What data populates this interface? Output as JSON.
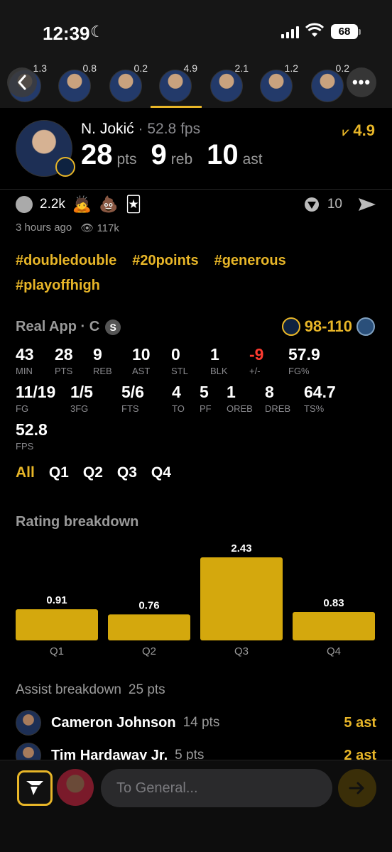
{
  "status": {
    "time": "12:39",
    "battery": "68"
  },
  "strip": {
    "players": [
      {
        "score": "1.3"
      },
      {
        "score": "0.8"
      },
      {
        "score": "0.2"
      },
      {
        "score": "4.9"
      },
      {
        "score": "2.1"
      },
      {
        "score": "1.2"
      },
      {
        "score": "0.2"
      }
    ],
    "active_index": 3
  },
  "player": {
    "name": "N. Jokić",
    "fps_text": "· 52.8 fps",
    "rating": "4.9",
    "pts": "28",
    "pts_label": "pts",
    "reb": "9",
    "reb_label": "reb",
    "ast": "10",
    "ast_label": "ast"
  },
  "reactions": {
    "count": "2.2k",
    "emoji": [
      "🙇",
      "💩",
      "🃏"
    ],
    "shares": "10",
    "time_ago": "3 hours ago",
    "views": "117k"
  },
  "tags": [
    "#doubledouble",
    "#20points",
    "#generous",
    "#playoffhigh"
  ],
  "game": {
    "source": "Real App · C",
    "badge": "S",
    "score_home": "98",
    "score_sep": "-",
    "score_away": "110"
  },
  "stats_row1": [
    {
      "v": "43",
      "k": "MIN"
    },
    {
      "v": "28",
      "k": "PTS"
    },
    {
      "v": "9",
      "k": "REB"
    },
    {
      "v": "10",
      "k": "AST"
    },
    {
      "v": "0",
      "k": "STL"
    },
    {
      "v": "1",
      "k": "BLK"
    },
    {
      "v": "-9",
      "k": "+/-"
    },
    {
      "v": "57.9",
      "k": "FG%"
    }
  ],
  "stats_row2": [
    {
      "v": "11/19",
      "k": "FG"
    },
    {
      "v": "1/5",
      "k": "3FG"
    },
    {
      "v": "5/6",
      "k": "FTS"
    },
    {
      "v": "4",
      "k": "TO"
    },
    {
      "v": "5",
      "k": "PF"
    },
    {
      "v": "1",
      "k": "OREB"
    },
    {
      "v": "8",
      "k": "DREB"
    },
    {
      "v": "64.7",
      "k": "TS%"
    }
  ],
  "stats_row3": [
    {
      "v": "52.8",
      "k": "FPS"
    }
  ],
  "quarter_tabs": [
    "All",
    "Q1",
    "Q2",
    "Q3",
    "Q4"
  ],
  "rating_title": "Rating breakdown",
  "chart_data": {
    "type": "bar",
    "categories": [
      "Q1",
      "Q2",
      "Q3",
      "Q4"
    ],
    "values": [
      0.91,
      0.76,
      2.43,
      0.83
    ],
    "value_labels": [
      "0.91",
      "0.76",
      "2.43",
      "0.83"
    ],
    "color": "#d4a80d"
  },
  "assists": {
    "title": "Assist breakdown",
    "total": "25 pts",
    "rows": [
      {
        "name": "Cameron Johnson",
        "pts": "14 pts",
        "ast": "5 ast"
      },
      {
        "name": "Tim Hardaway Jr.",
        "pts": "5 pts",
        "ast": "2 ast"
      }
    ]
  },
  "composer": {
    "placeholder": "To General..."
  },
  "colors": {
    "accent": "#e8b628",
    "negative": "#ff3b30",
    "background": "#000000"
  }
}
